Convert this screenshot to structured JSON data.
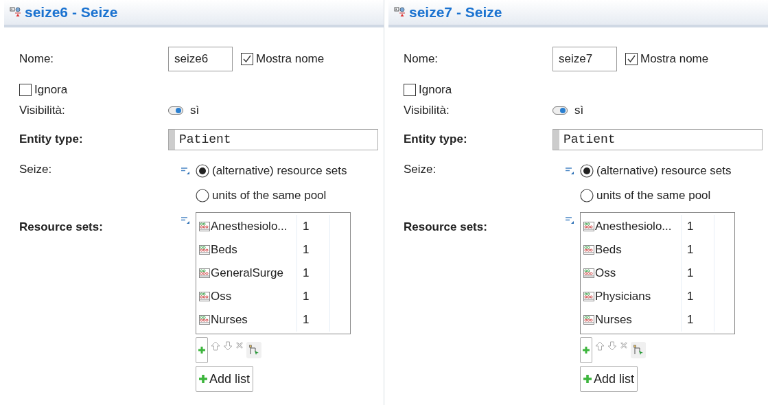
{
  "panels": [
    {
      "title": "seize6 - Seize",
      "name_label": "Nome:",
      "name_value": "seize6",
      "show_name": {
        "label": "Mostra nome",
        "checked": true
      },
      "ignore": {
        "label": "Ignora",
        "checked": false
      },
      "visibility_label": "Visibilità:",
      "visibility": {
        "label": "sì",
        "on": true
      },
      "entity_label": "Entity type:",
      "entity_value": "Patient",
      "seize_label": "Seize:",
      "seize_options": [
        {
          "label": "(alternative) resource sets",
          "selected": true
        },
        {
          "label": "units of the same pool",
          "selected": false
        }
      ],
      "resource_label": "Resource sets:",
      "resources": [
        {
          "name": "Anesthesiolo...",
          "count": "1"
        },
        {
          "name": "Beds",
          "count": "1"
        },
        {
          "name": "GeneralSurge",
          "count": "1"
        },
        {
          "name": "Oss",
          "count": "1"
        },
        {
          "name": "Nurses",
          "count": "1"
        }
      ],
      "add_list_label": "Add list"
    },
    {
      "title": "seize7 - Seize",
      "name_label": "Nome:",
      "name_value": "seize7",
      "show_name": {
        "label": "Mostra nome",
        "checked": true
      },
      "ignore": {
        "label": "Ignora",
        "checked": false
      },
      "visibility_label": "Visibilità:",
      "visibility": {
        "label": "sì",
        "on": true
      },
      "entity_label": "Entity type:",
      "entity_value": "Patient",
      "seize_label": "Seize:",
      "seize_options": [
        {
          "label": "(alternative) resource sets",
          "selected": true
        },
        {
          "label": "units of the same pool",
          "selected": false
        }
      ],
      "resource_label": "Resource sets:",
      "resources": [
        {
          "name": "Anesthesiolo...",
          "count": "1"
        },
        {
          "name": "Beds",
          "count": "1"
        },
        {
          "name": "Oss",
          "count": "1"
        },
        {
          "name": "Physicians",
          "count": "1"
        },
        {
          "name": "Nurses",
          "count": "1"
        }
      ],
      "add_list_label": "Add list"
    }
  ]
}
